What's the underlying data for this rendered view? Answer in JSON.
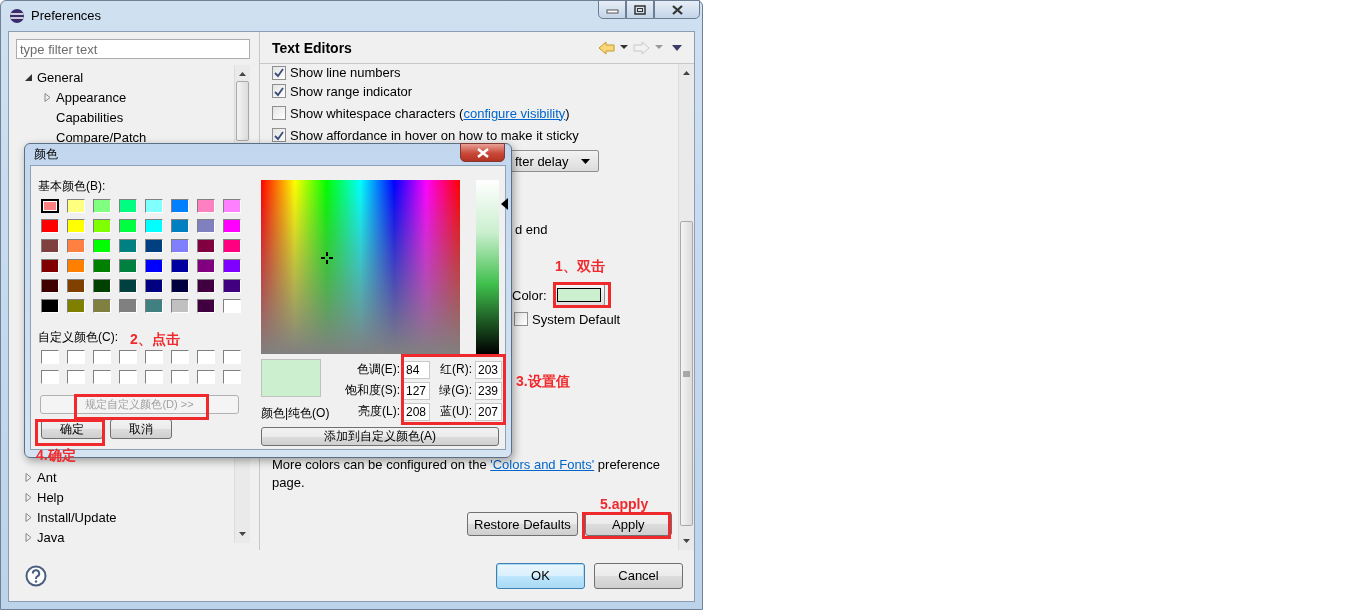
{
  "window": {
    "title": "Preferences"
  },
  "filter": {
    "placeholder": "type filter text"
  },
  "tree": [
    {
      "label": "General",
      "expanded": true,
      "children": [
        {
          "label": "Appearance",
          "expanded": false
        },
        {
          "label": "Capabilities"
        },
        {
          "label": "Compare/Patch"
        }
      ]
    },
    {
      "label": "Ant",
      "expanded": false
    },
    {
      "label": "Help",
      "expanded": false
    },
    {
      "label": "Install/Update",
      "expanded": false
    },
    {
      "label": "Java",
      "expanded": false
    }
  ],
  "page": {
    "title": "Text Editors",
    "options": [
      {
        "kind": "checkbox",
        "label": "Show line numbers",
        "checked": true
      },
      {
        "kind": "checkbox",
        "label": "Show range indicator",
        "checked": true
      },
      {
        "kind": "checkbox",
        "label": "Show whitespace characters (",
        "link": "configure visibility",
        "after": ")",
        "checked": false
      },
      {
        "kind": "checkbox",
        "label": "Show affordance in hover on how to make it sticky",
        "checked": true
      }
    ],
    "hover_dropdown": {
      "value": "fter delay"
    },
    "partial_text": "d end",
    "color_setting": {
      "label": "Color:",
      "color": "#cbefcf"
    },
    "system_default": {
      "label": "System Default",
      "checked": false
    },
    "note": {
      "before": "More colors can be configured on the ",
      "link": "'Colors and Fonts'",
      "after": " preference page."
    },
    "restore_button": "Restore Defaults",
    "apply_button": "Apply"
  },
  "footer": {
    "ok": "OK",
    "cancel": "Cancel"
  },
  "color_dialog": {
    "title": "颜色",
    "basic_label": "基本颜色(B):",
    "basic_colors": [
      {
        "color": "#ff8080",
        "selected": true
      },
      {
        "color": "#ffff80",
        "selected": false
      },
      {
        "color": "#80ff80",
        "selected": false
      },
      {
        "color": "#00ff80",
        "selected": false
      },
      {
        "color": "#80ffff",
        "selected": false
      },
      {
        "color": "#0080ff",
        "selected": false
      },
      {
        "color": "#ff80c0",
        "selected": false
      },
      {
        "color": "#ff80ff",
        "selected": false
      },
      {
        "color": "#ff0000",
        "selected": false
      },
      {
        "color": "#ffff00",
        "selected": false
      },
      {
        "color": "#80ff00",
        "selected": false
      },
      {
        "color": "#00ff40",
        "selected": false
      },
      {
        "color": "#00ffff",
        "selected": false
      },
      {
        "color": "#0080c0",
        "selected": false
      },
      {
        "color": "#8080c0",
        "selected": false
      },
      {
        "color": "#ff00ff",
        "selected": false
      },
      {
        "color": "#804040",
        "selected": false
      },
      {
        "color": "#ff8040",
        "selected": false
      },
      {
        "color": "#00ff00",
        "selected": false
      },
      {
        "color": "#008080",
        "selected": false
      },
      {
        "color": "#004080",
        "selected": false
      },
      {
        "color": "#8080ff",
        "selected": false
      },
      {
        "color": "#800040",
        "selected": false
      },
      {
        "color": "#ff0080",
        "selected": false
      },
      {
        "color": "#800000",
        "selected": false
      },
      {
        "color": "#ff8000",
        "selected": false
      },
      {
        "color": "#008000",
        "selected": false
      },
      {
        "color": "#008040",
        "selected": false
      },
      {
        "color": "#0000ff",
        "selected": false
      },
      {
        "color": "#0000a0",
        "selected": false
      },
      {
        "color": "#800080",
        "selected": false
      },
      {
        "color": "#8000ff",
        "selected": false
      },
      {
        "color": "#400000",
        "selected": false
      },
      {
        "color": "#804000",
        "selected": false
      },
      {
        "color": "#004000",
        "selected": false
      },
      {
        "color": "#004040",
        "selected": false
      },
      {
        "color": "#000080",
        "selected": false
      },
      {
        "color": "#000040",
        "selected": false
      },
      {
        "color": "#400040",
        "selected": false
      },
      {
        "color": "#400080",
        "selected": false
      },
      {
        "color": "#000000",
        "selected": false
      },
      {
        "color": "#808000",
        "selected": false
      },
      {
        "color": "#808040",
        "selected": false
      },
      {
        "color": "#808080",
        "selected": false
      },
      {
        "color": "#408080",
        "selected": false
      },
      {
        "color": "#c0c0c0",
        "selected": false
      },
      {
        "color": "#400040",
        "selected": false
      },
      {
        "color": "#ffffff",
        "selected": false
      }
    ],
    "custom_label": "自定义颜色(C):",
    "custom_colors": [
      {
        "color": "#ffffff"
      },
      {
        "color": "#ffffff"
      },
      {
        "color": "#ffffff"
      },
      {
        "color": "#ffffff"
      },
      {
        "color": "#ffffff"
      },
      {
        "color": "#ffffff"
      },
      {
        "color": "#ffffff"
      },
      {
        "color": "#ffffff"
      },
      {
        "color": "#ffffff"
      },
      {
        "color": "#ffffff"
      },
      {
        "color": "#ffffff"
      },
      {
        "color": "#ffffff"
      },
      {
        "color": "#ffffff"
      },
      {
        "color": "#ffffff"
      },
      {
        "color": "#ffffff"
      },
      {
        "color": "#ffffff"
      }
    ],
    "define_button": {
      "label": "规定自定义颜色(D) >>",
      "disabled": true
    },
    "preview_label": "颜色|纯色(O)",
    "fields": [
      {
        "label": "色调(E):",
        "value": "84"
      },
      {
        "label": "红(R):",
        "value": "203"
      },
      {
        "label": "饱和度(S):",
        "value": "127"
      },
      {
        "label": "绿(G):",
        "value": "239"
      },
      {
        "label": "亮度(L):",
        "value": "208"
      },
      {
        "label": "蓝(U):",
        "value": "207"
      }
    ],
    "add_button": "添加到自定义颜色(A)",
    "ok": "确定",
    "cancel": "取消"
  },
  "annotations": [
    {
      "text": "1、双击"
    },
    {
      "text": "2、点击"
    },
    {
      "text": "3.设置值"
    },
    {
      "text": "4.确定"
    },
    {
      "text": "5.apply"
    }
  ]
}
